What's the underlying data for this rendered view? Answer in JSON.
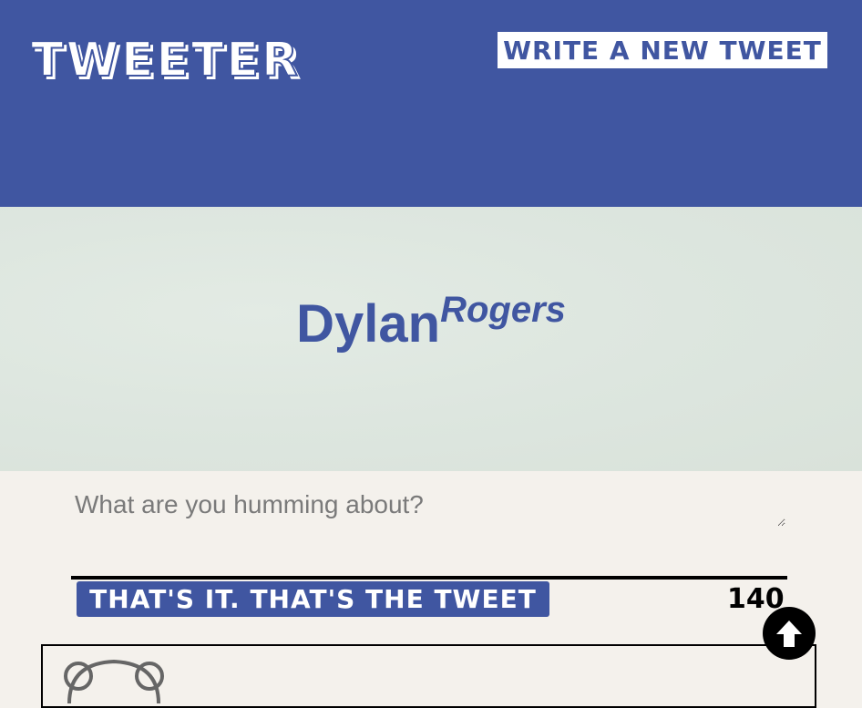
{
  "header": {
    "logo": "TWEETER",
    "write_button": "WRITE A NEW TWEET",
    "background_color": "#4056a1"
  },
  "profile": {
    "first_name": "Dylan",
    "last_name": "Rogers"
  },
  "composer": {
    "placeholder": "What are you humming about?",
    "value": "",
    "submit_label": "THAT'S IT. THAT'S THE TWEET",
    "char_counter": "140"
  },
  "icons": {
    "scroll_up": "arrow-up-circle-icon",
    "avatar": "avatar-icon"
  },
  "colors": {
    "accent": "#4056a1",
    "page_bg": "#f4f1ec",
    "hero_bg": "#dde6df"
  }
}
